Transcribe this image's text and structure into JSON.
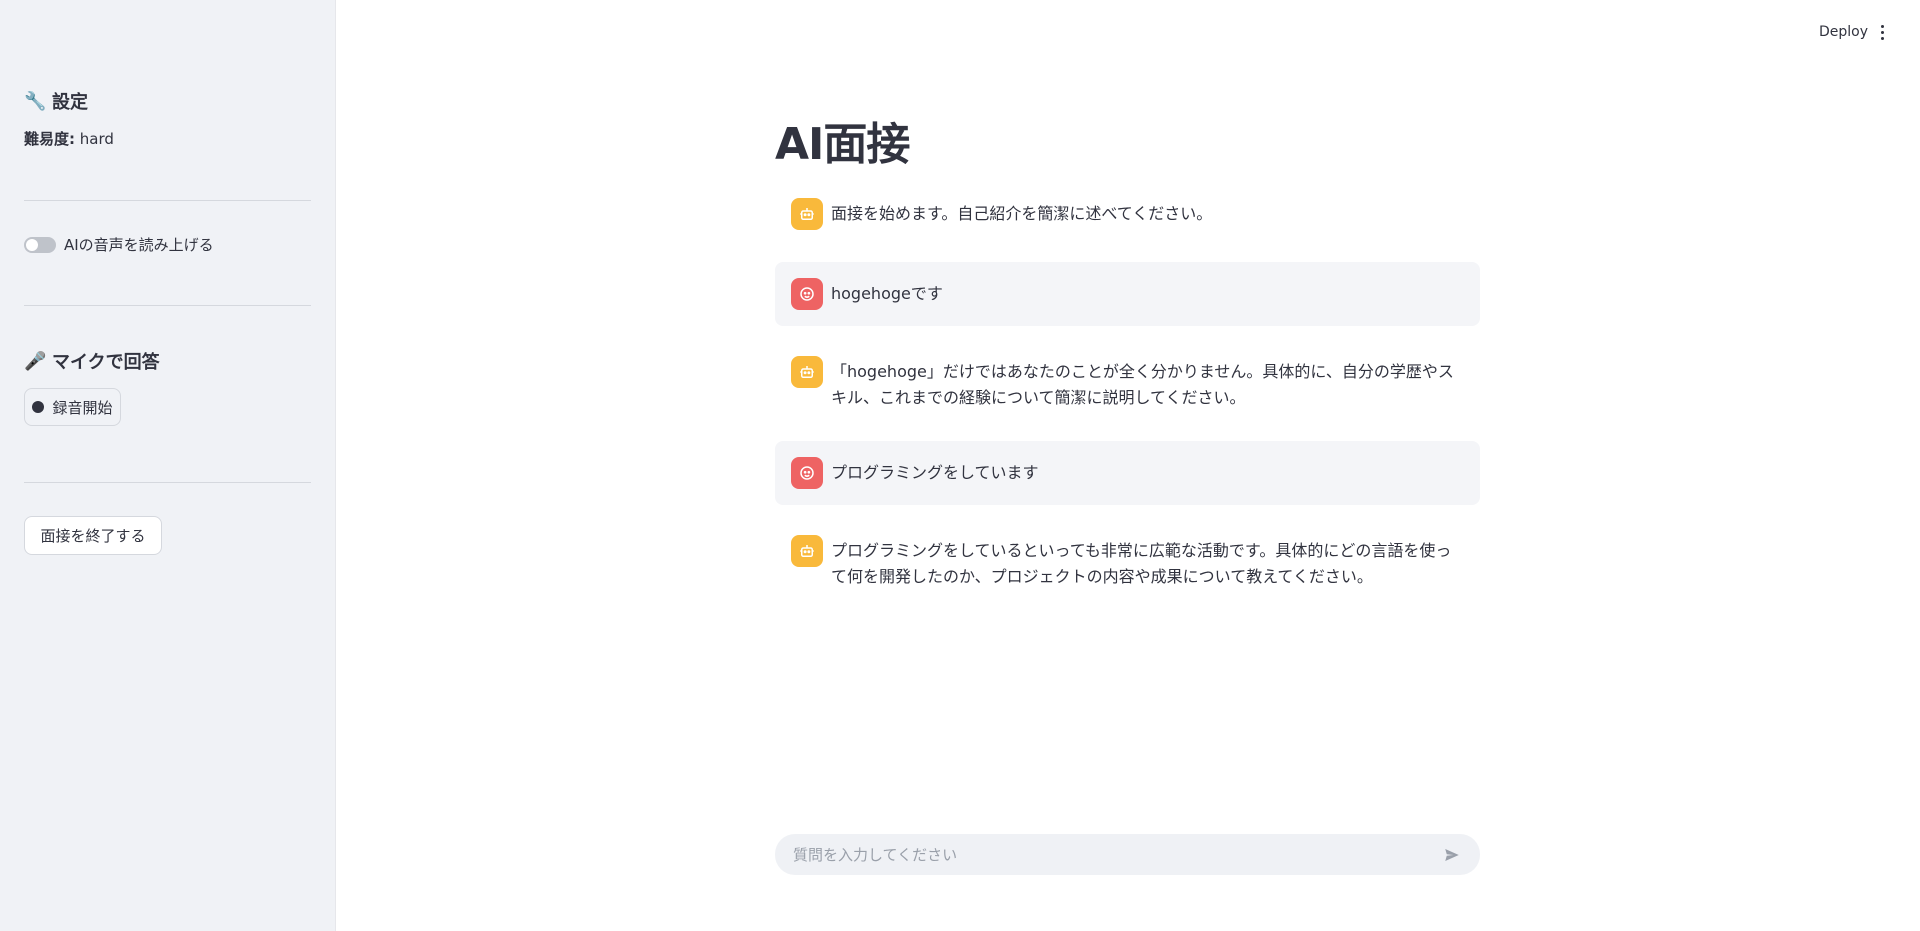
{
  "header": {
    "deploy_label": "Deploy",
    "menu_icon": "kebab-menu-icon"
  },
  "sidebar": {
    "settings": {
      "icon": "wrench-icon",
      "emoji": "🔧",
      "title": "設定"
    },
    "difficulty": {
      "label": "難易度:",
      "value": "hard"
    },
    "voice_toggle": {
      "label": "AIの音声を読み上げる",
      "on": false
    },
    "mic": {
      "icon": "microphone-icon",
      "emoji": "🎤",
      "title": "マイクで回答",
      "record_label": "録音開始"
    },
    "end_button_label": "面接を終了する"
  },
  "main": {
    "title": "AI面接",
    "messages": [
      {
        "role": "assistant",
        "avatar": "bot-icon",
        "text": "面接を始めます。自己紹介を簡潔に述べてください。"
      },
      {
        "role": "user",
        "avatar": "user-face-icon",
        "text": "hogehogeです"
      },
      {
        "role": "assistant",
        "avatar": "bot-icon",
        "text": "「hogehoge」だけではあなたのことが全く分かりません。具体的に、自分の学歴やスキル、これまでの経験について簡潔に説明してください。"
      },
      {
        "role": "user",
        "avatar": "user-face-icon",
        "text": "プログラミングをしています"
      },
      {
        "role": "assistant",
        "avatar": "bot-icon",
        "text": "プログラミングをしているといっても非常に広範な活動です。具体的にどの言語を使って何を開発したのか、プロジェクトの内容や成果について教えてください。"
      }
    ],
    "chat_input": {
      "placeholder": "質問を入力してください",
      "value": "",
      "send_icon": "send-icon"
    }
  },
  "colors": {
    "sidebar_bg": "#f0f2f6",
    "bot_avatar": "#f9b93b",
    "user_avatar": "#ee6363",
    "user_msg_bg": "#f4f5f8",
    "text": "#31333f"
  }
}
